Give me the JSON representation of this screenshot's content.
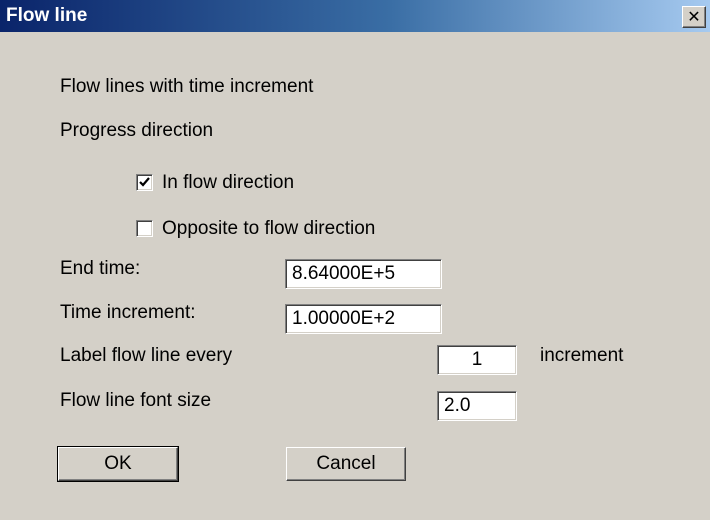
{
  "window": {
    "title": "Flow line",
    "close_glyph": "✕",
    "close_icon": "close-icon"
  },
  "header_text": "Flow lines with time increment",
  "progress": {
    "label": "Progress direction",
    "options": [
      {
        "label": "In flow direction",
        "checked": true
      },
      {
        "label": "Opposite to flow direction",
        "checked": false
      }
    ]
  },
  "fields": {
    "end_time": {
      "label": "End time:",
      "value": "8.64000E+5"
    },
    "time_increment": {
      "label": "Time increment:",
      "value": "1.00000E+2"
    },
    "label_every": {
      "label": "Label flow line every",
      "value": "1",
      "suffix": "increment"
    },
    "font_size": {
      "label": "Flow line font size",
      "value": "2.0"
    }
  },
  "buttons": {
    "ok": "OK",
    "cancel": "Cancel"
  }
}
